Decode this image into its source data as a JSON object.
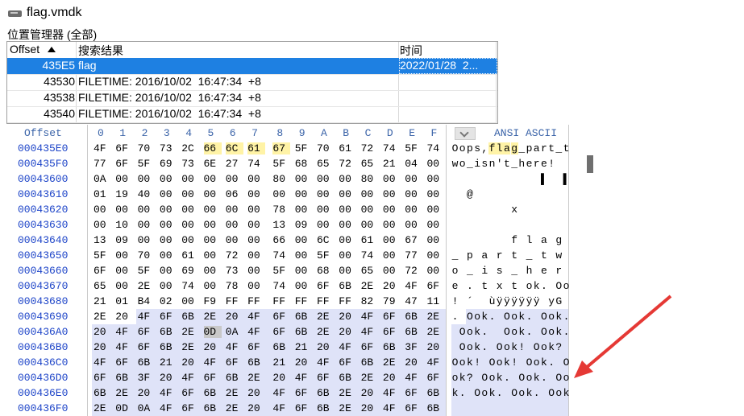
{
  "window": {
    "title": "flag.vmdk",
    "drive_icon": "hard-drive-icon"
  },
  "position_manager": {
    "label": "位置管理器 (全部)",
    "columns": {
      "offset": "Offset",
      "result": "搜索结果",
      "time": "时间"
    },
    "sort_icon": "sort-up-icon",
    "rows": [
      {
        "offset": "435E5",
        "result": "flag",
        "time": "2022/01/28  2...",
        "selected": true
      },
      {
        "offset": "43530",
        "result": "FILETIME: 2016/10/02  16:47:34  +8",
        "time": ""
      },
      {
        "offset": "43538",
        "result": "FILETIME: 2016/10/02  16:47:34  +8",
        "time": ""
      },
      {
        "offset": "43540",
        "result": "FILETIME: 2016/10/02  16:47:34  +8",
        "time": ""
      }
    ]
  },
  "hex_view": {
    "offset_header": "Offset",
    "col_headers": [
      "0",
      "1",
      "2",
      "3",
      "4",
      "5",
      "6",
      "7",
      "8",
      "9",
      "A",
      "B",
      "C",
      "D",
      "E",
      "F"
    ],
    "ascii_header": "ANSI ASCII",
    "rows": [
      {
        "offset": "000435E0",
        "bytes": [
          "4F",
          "6F",
          "70",
          "73",
          "2C",
          "66",
          "6C",
          "61",
          "67",
          "5F",
          "70",
          "61",
          "72",
          "74",
          "5F",
          "74"
        ],
        "ascii": [
          "O",
          "o",
          "p",
          "s",
          ",",
          "f",
          "l",
          "a",
          "g",
          "_",
          "p",
          "a",
          "r",
          "t",
          "_",
          "t"
        ]
      },
      {
        "offset": "000435F0",
        "bytes": [
          "77",
          "6F",
          "5F",
          "69",
          "73",
          "6E",
          "27",
          "74",
          "5F",
          "68",
          "65",
          "72",
          "65",
          "21",
          "04",
          "00"
        ],
        "ascii": [
          "w",
          "o",
          "_",
          "i",
          "s",
          "n",
          "'",
          "t",
          "_",
          "h",
          "e",
          "r",
          "e",
          "!",
          "",
          ""
        ]
      },
      {
        "offset": "00043600",
        "bytes": [
          "0A",
          "00",
          "00",
          "00",
          "00",
          "00",
          "00",
          "00",
          "80",
          "00",
          "00",
          "00",
          "80",
          "00",
          "00",
          "00"
        ],
        "ascii": [
          "",
          "",
          "",
          "",
          "",
          "",
          "",
          "",
          "",
          "",
          "",
          "",
          "▌",
          "",
          "",
          "▌"
        ]
      },
      {
        "offset": "00043610",
        "bytes": [
          "01",
          "19",
          "40",
          "00",
          "00",
          "00",
          "06",
          "00",
          "00",
          "00",
          "00",
          "00",
          "00",
          "00",
          "00",
          "00"
        ],
        "ascii": [
          "",
          "",
          "@",
          "",
          "",
          "",
          "",
          "",
          "",
          "",
          "",
          "",
          "",
          "",
          "",
          ""
        ]
      },
      {
        "offset": "00043620",
        "bytes": [
          "00",
          "00",
          "00",
          "00",
          "00",
          "00",
          "00",
          "00",
          "78",
          "00",
          "00",
          "00",
          "00",
          "00",
          "00",
          "00"
        ],
        "ascii": [
          "",
          "",
          "",
          "",
          "",
          "",
          "",
          "",
          "x",
          "",
          "",
          "",
          "",
          "",
          "",
          ""
        ]
      },
      {
        "offset": "00043630",
        "bytes": [
          "00",
          "10",
          "00",
          "00",
          "00",
          "00",
          "00",
          "00",
          "13",
          "09",
          "00",
          "00",
          "00",
          "00",
          "00",
          "00"
        ],
        "ascii": [
          "",
          "",
          "",
          "",
          "",
          "",
          "",
          "",
          "",
          "",
          "",
          "",
          "",
          "",
          "",
          ""
        ]
      },
      {
        "offset": "00043640",
        "bytes": [
          "13",
          "09",
          "00",
          "00",
          "00",
          "00",
          "00",
          "00",
          "66",
          "00",
          "6C",
          "00",
          "61",
          "00",
          "67",
          "00"
        ],
        "ascii": [
          "",
          "",
          "",
          "",
          "",
          "",
          "",
          "",
          "f",
          "",
          "l",
          "",
          "a",
          "",
          "g",
          ""
        ]
      },
      {
        "offset": "00043650",
        "bytes": [
          "5F",
          "00",
          "70",
          "00",
          "61",
          "00",
          "72",
          "00",
          "74",
          "00",
          "5F",
          "00",
          "74",
          "00",
          "77",
          "00"
        ],
        "ascii": [
          "_",
          "",
          "p",
          "",
          "a",
          "",
          "r",
          "",
          "t",
          "",
          "_",
          "",
          "t",
          "",
          "w",
          ""
        ]
      },
      {
        "offset": "00043660",
        "bytes": [
          "6F",
          "00",
          "5F",
          "00",
          "69",
          "00",
          "73",
          "00",
          "5F",
          "00",
          "68",
          "00",
          "65",
          "00",
          "72",
          "00"
        ],
        "ascii": [
          "o",
          "",
          "_",
          "",
          "i",
          "",
          "s",
          "",
          "_",
          "",
          "h",
          "",
          "e",
          "",
          "r",
          ""
        ]
      },
      {
        "offset": "00043670",
        "bytes": [
          "65",
          "00",
          "2E",
          "00",
          "74",
          "00",
          "78",
          "00",
          "74",
          "00",
          "6F",
          "6B",
          "2E",
          "20",
          "4F",
          "6F"
        ],
        "ascii": [
          "e",
          "",
          ".",
          "",
          "t",
          "",
          "x",
          "",
          "t",
          "",
          "o",
          "k",
          ".",
          " ",
          "O",
          "o"
        ]
      },
      {
        "offset": "00043680",
        "bytes": [
          "21",
          "01",
          "B4",
          "02",
          "00",
          "F9",
          "FF",
          "FF",
          "FF",
          "FF",
          "FF",
          "FF",
          "82",
          "79",
          "47",
          "11"
        ],
        "ascii": [
          "!",
          "",
          "´",
          "",
          "",
          "ù",
          "ÿ",
          "ÿ",
          "ÿ",
          "ÿ",
          "ÿ",
          "ÿ",
          "",
          "y",
          "G",
          ""
        ]
      },
      {
        "offset": "00043690",
        "bytes": [
          "2E",
          "20",
          "4F",
          "6F",
          "6B",
          "2E",
          "20",
          "4F",
          "6F",
          "6B",
          "2E",
          "20",
          "4F",
          "6F",
          "6B",
          "2E"
        ],
        "ascii": [
          ".",
          " ",
          "O",
          "o",
          "k",
          ".",
          " ",
          "O",
          "o",
          "k",
          ".",
          " ",
          "O",
          "o",
          "k",
          "."
        ]
      },
      {
        "offset": "000436A0",
        "bytes": [
          "20",
          "4F",
          "6F",
          "6B",
          "2E",
          "0D",
          "0A",
          "4F",
          "6F",
          "6B",
          "2E",
          "20",
          "4F",
          "6F",
          "6B",
          "2E"
        ],
        "ascii": [
          " ",
          "O",
          "o",
          "k",
          ".",
          "",
          "",
          "O",
          "o",
          "k",
          ".",
          " ",
          "O",
          "o",
          "k",
          "."
        ]
      },
      {
        "offset": "000436B0",
        "bytes": [
          "20",
          "4F",
          "6F",
          "6B",
          "2E",
          "20",
          "4F",
          "6F",
          "6B",
          "21",
          "20",
          "4F",
          "6F",
          "6B",
          "3F",
          "20"
        ],
        "ascii": [
          " ",
          "O",
          "o",
          "k",
          ".",
          " ",
          "O",
          "o",
          "k",
          "!",
          " ",
          "O",
          "o",
          "k",
          "?",
          ""
        ]
      },
      {
        "offset": "000436C0",
        "bytes": [
          "4F",
          "6F",
          "6B",
          "21",
          "20",
          "4F",
          "6F",
          "6B",
          "21",
          "20",
          "4F",
          "6F",
          "6B",
          "2E",
          "20",
          "4F"
        ],
        "ascii": [
          "O",
          "o",
          "k",
          "!",
          " ",
          "O",
          "o",
          "k",
          "!",
          " ",
          "O",
          "o",
          "k",
          ".",
          " ",
          "O"
        ]
      },
      {
        "offset": "000436D0",
        "bytes": [
          "6F",
          "6B",
          "3F",
          "20",
          "4F",
          "6F",
          "6B",
          "2E",
          "20",
          "4F",
          "6F",
          "6B",
          "2E",
          "20",
          "4F",
          "6F"
        ],
        "ascii": [
          "o",
          "k",
          "?",
          " ",
          "O",
          "o",
          "k",
          ".",
          " ",
          "O",
          "o",
          "k",
          ".",
          " ",
          "O",
          "o"
        ]
      },
      {
        "offset": "000436E0",
        "bytes": [
          "6B",
          "2E",
          "20",
          "4F",
          "6F",
          "6B",
          "2E",
          "20",
          "4F",
          "6F",
          "6B",
          "2E",
          "20",
          "4F",
          "6F",
          "6B"
        ],
        "ascii": [
          "k",
          ".",
          " ",
          "O",
          "o",
          "k",
          ".",
          " ",
          "O",
          "o",
          "k",
          ".",
          " ",
          "O",
          "o",
          "k"
        ]
      },
      {
        "offset": "000436F0",
        "bytes": [
          "2E",
          "0D",
          "0A",
          "4F",
          "6F",
          "6B",
          "2E",
          "20",
          "4F",
          "6F",
          "6B",
          "2E",
          "20",
          "4F",
          "6F",
          "6B"
        ],
        "ascii": [
          "",
          "",
          "",
          "",
          "",
          "",
          "",
          "",
          "",
          "",
          "",
          "",
          "",
          "",
          "",
          ""
        ]
      }
    ]
  },
  "colors": {
    "selection": "#1e80e2",
    "highlight": "#fff3a6",
    "block": "#dfe3f8",
    "offset_text": "#1d44c8",
    "arrow": "#e53935"
  }
}
